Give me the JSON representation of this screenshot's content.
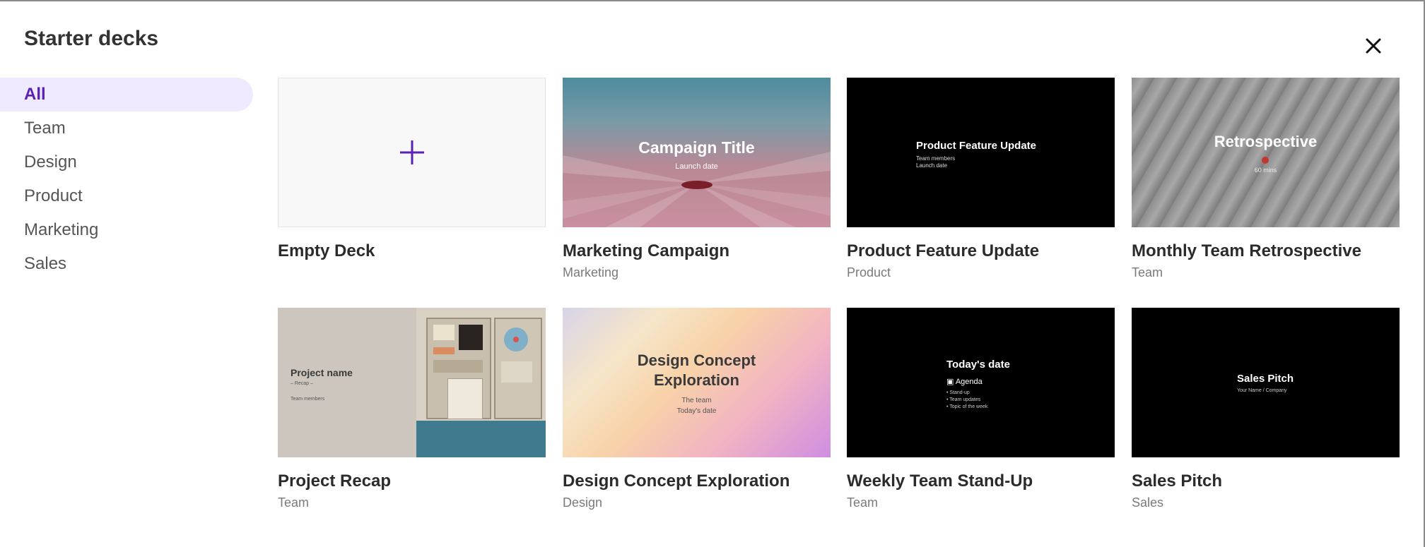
{
  "dialog": {
    "title": "Starter decks"
  },
  "sidebar": {
    "items": [
      {
        "label": "All"
      },
      {
        "label": "Team"
      },
      {
        "label": "Design"
      },
      {
        "label": "Product"
      },
      {
        "label": "Marketing"
      },
      {
        "label": "Sales"
      }
    ]
  },
  "decks": [
    {
      "title": "Empty Deck",
      "category": ""
    },
    {
      "title": "Marketing Campaign",
      "category": "Marketing",
      "thumb": {
        "heading": "Campaign Title",
        "sub": "Launch date"
      }
    },
    {
      "title": "Product Feature Update",
      "category": "Product",
      "thumb": {
        "heading": "Product Feature Update",
        "line1": "Team members",
        "line2": "Launch date"
      }
    },
    {
      "title": "Monthly Team Retrospective",
      "category": "Team",
      "thumb": {
        "heading": "Retrospective",
        "sub": "60 mins"
      }
    },
    {
      "title": "Project Recap",
      "category": "Team",
      "thumb": {
        "heading": "Project name",
        "line1": "– Recap –",
        "line2": "Team members"
      }
    },
    {
      "title": "Design Concept Exploration",
      "category": "Design",
      "thumb": {
        "heading_line1": "Design Concept",
        "heading_line2": "Exploration",
        "line1": "The team",
        "line2": "Today's date"
      }
    },
    {
      "title": "Weekly Team Stand-Up",
      "category": "Team",
      "thumb": {
        "heading": "Today's date",
        "agenda": "Agenda",
        "bullets": [
          "Stand-up",
          "Team updates",
          "Topic of the week"
        ]
      }
    },
    {
      "title": "Sales Pitch",
      "category": "Sales",
      "thumb": {
        "heading": "Sales Pitch",
        "sub": "Your Name / Company"
      }
    }
  ],
  "colors": {
    "accent": "#5b21b6",
    "active_bg": "#efeaff"
  }
}
